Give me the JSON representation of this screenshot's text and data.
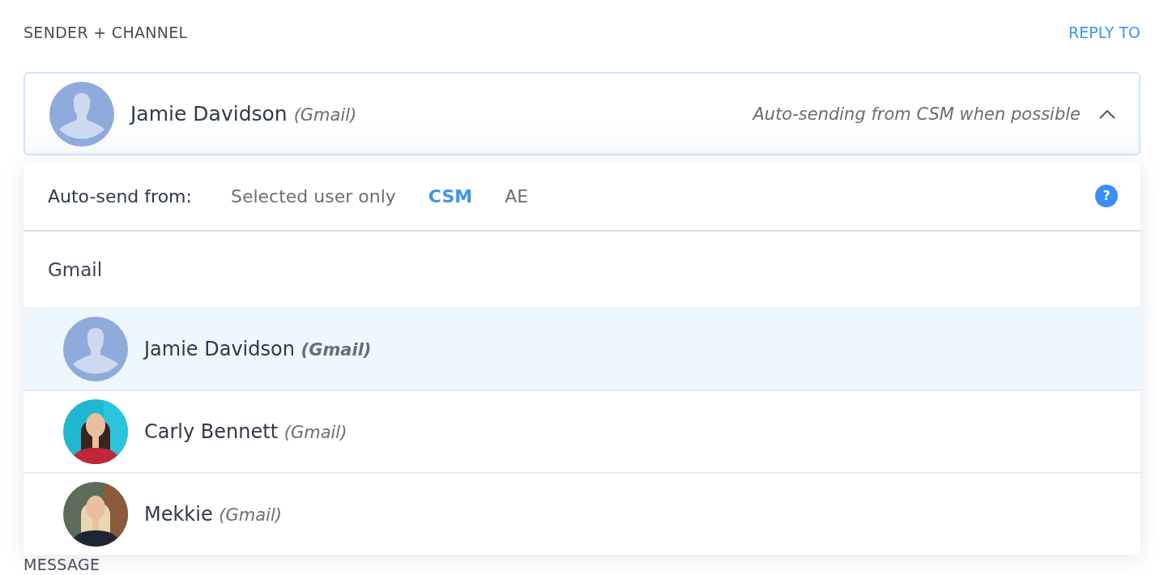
{
  "header": {
    "title": "SENDER + CHANNEL",
    "link": "REPLY TO"
  },
  "sender": {
    "kind": "placeholder",
    "name": "Jamie Davidson",
    "channel": "(Gmail)",
    "status": "Auto-sending from CSM when possible",
    "expanded": true
  },
  "dropdown": {
    "label": "Auto-send from:",
    "options": [
      {
        "label": "Selected user only",
        "selected": false
      },
      {
        "label": "CSM",
        "selected": true
      },
      {
        "label": "AE",
        "selected": false
      }
    ],
    "help": "?",
    "group": "Gmail",
    "users": [
      {
        "kind": "placeholder",
        "name": "Jamie Davidson",
        "channel": "(Gmail)",
        "selected": true
      },
      {
        "name": "Carly Bennett",
        "channel": "(Gmail)",
        "selected": false
      },
      {
        "name": "Mekkie",
        "channel": "(Gmail)",
        "selected": false
      }
    ]
  },
  "next_section": {
    "title": "MESSAGE"
  }
}
